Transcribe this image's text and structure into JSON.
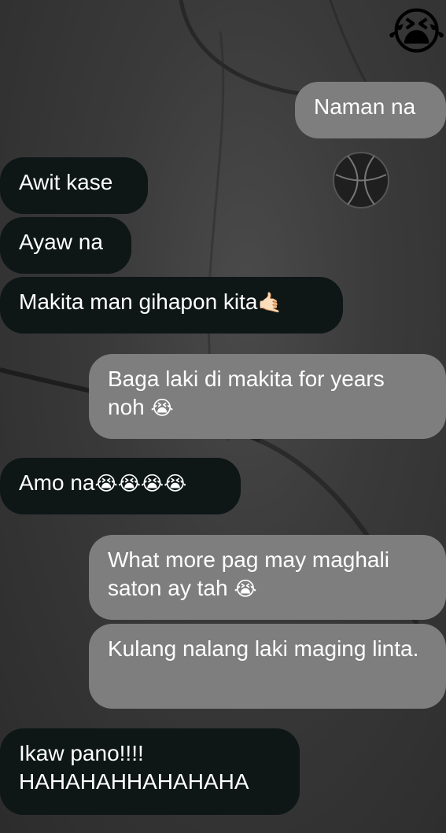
{
  "top_emoji": "😭",
  "messages": [
    {
      "side": "out",
      "text": "Naman na"
    },
    {
      "side": "in",
      "text": "Awit kase"
    },
    {
      "side": "in",
      "text": "Ayaw na"
    },
    {
      "side": "in",
      "text": "Makita man gihapon kita",
      "emoji": "🤙🏻"
    },
    {
      "side": "out",
      "text": "Baga laki di makita for years noh",
      "emoji": "😭"
    },
    {
      "side": "in",
      "text": "Amo na",
      "emoji": "😭😭😭😭"
    },
    {
      "side": "out",
      "text": "What more pag may maghali saton ay tah",
      "emoji": "😭"
    },
    {
      "side": "out",
      "text": "Kulang nalang laki maging linta."
    },
    {
      "side": "in",
      "text": "Ikaw pano!!!! HAHAHAHHAHAHAHA"
    }
  ],
  "colors": {
    "incoming_bubble": "#0e1616",
    "outgoing_bubble": "#7e7e7e",
    "text": "#ffffff"
  }
}
